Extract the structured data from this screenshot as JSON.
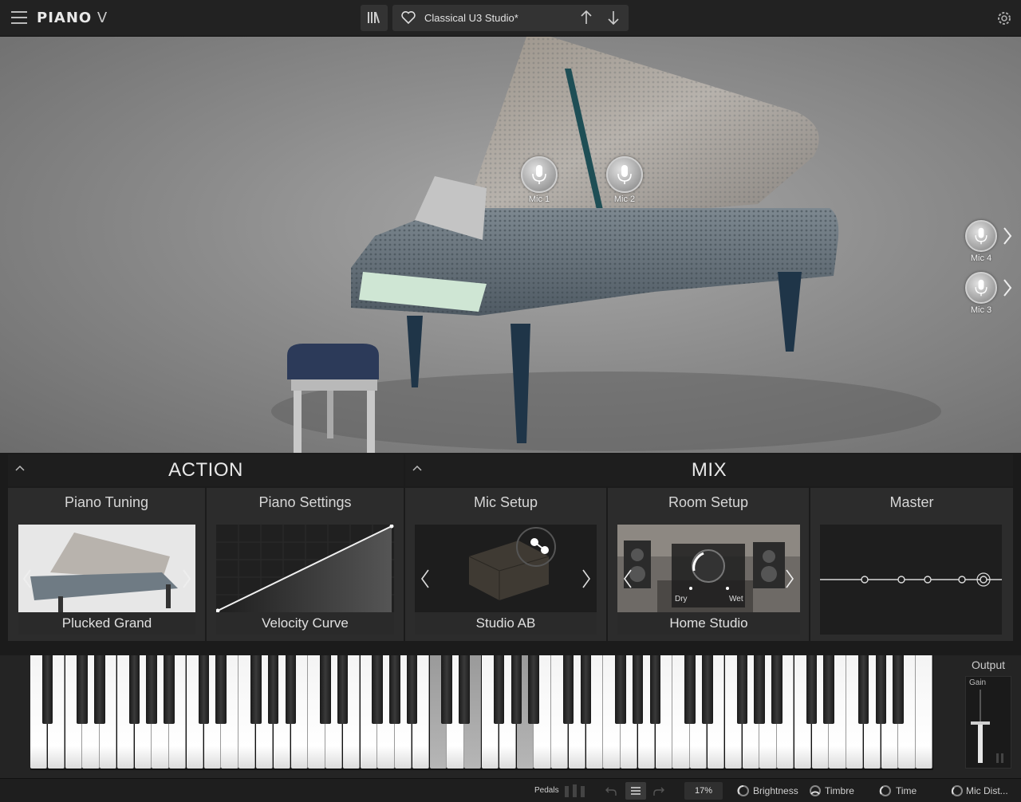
{
  "app": {
    "logo_main": "PIANO",
    "logo_v": " V"
  },
  "header": {
    "preset_name": "Classical U3 Studio*"
  },
  "mics": {
    "mic1": "Mic 1",
    "mic2": "Mic 2",
    "mic3": "Mic 3",
    "mic4": "Mic 4"
  },
  "sections": {
    "action": "ACTION",
    "mix": "MIX"
  },
  "panels": {
    "piano_tuning": {
      "title": "Piano Tuning",
      "caption": "Plucked Grand"
    },
    "piano_settings": {
      "title": "Piano Settings",
      "caption": "Velocity Curve"
    },
    "mic_setup": {
      "title": "Mic Setup",
      "caption": "Studio AB"
    },
    "room_setup": {
      "title": "Room Setup",
      "caption": "Home Studio",
      "dry": "Dry",
      "wet": "Wet"
    },
    "master": {
      "title": "Master"
    }
  },
  "output": {
    "title": "Output",
    "gain": "Gain"
  },
  "bottom": {
    "pedals": "Pedals",
    "zoom": "17%",
    "brightness": "Brightness",
    "timbre": "Timbre",
    "time": "Time",
    "mic_dist": "Mic Dist..."
  },
  "colors": {
    "accent": "#e8e8e8",
    "panel": "#2c2c2c",
    "background": "#1b1b1b"
  }
}
